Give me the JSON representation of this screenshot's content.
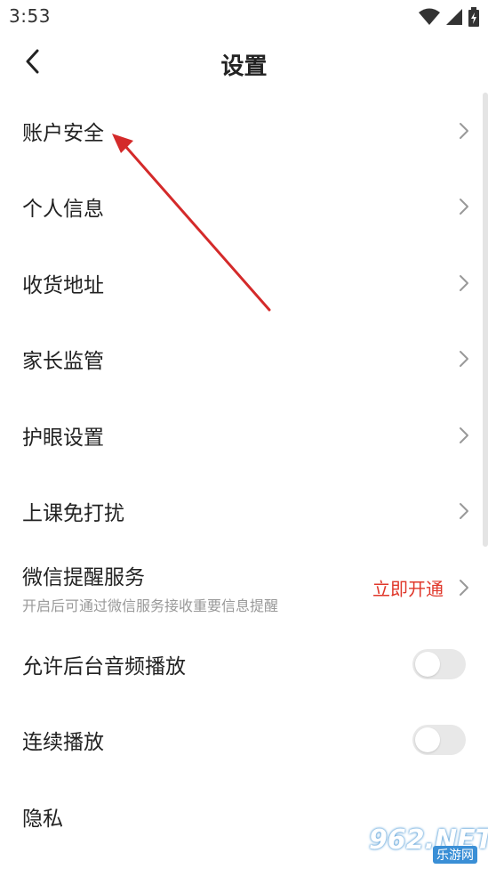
{
  "status_bar": {
    "time": "3:53",
    "icons": [
      "wifi-icon",
      "signal-icon",
      "battery-icon"
    ]
  },
  "header": {
    "title": "设置",
    "back_icon": "chevron-left-icon"
  },
  "settings": {
    "account_security": "账户安全",
    "personal_info": "个人信息",
    "shipping_address": "收货地址",
    "parental_control": "家长监管",
    "eye_protection": "护眼设置",
    "class_do_not_disturb": "上课免打扰",
    "wechat_reminder": {
      "label": "微信提醒服务",
      "subtitle": "开启后可通过微信服务接收重要信息提醒",
      "action": "立即开通"
    },
    "background_audio": "允许后台音频播放",
    "continuous_play": "连续播放",
    "privacy": "隐私"
  },
  "toggles": {
    "background_audio_enabled": false,
    "continuous_play_enabled": false
  },
  "watermark": {
    "main": "962.NET",
    "sub": "乐游网"
  },
  "colors": {
    "accent_red": "#e0382b",
    "annotation_arrow": "#d42a2a",
    "chevron": "#999999",
    "toggle_off": "#e8e8e8"
  }
}
